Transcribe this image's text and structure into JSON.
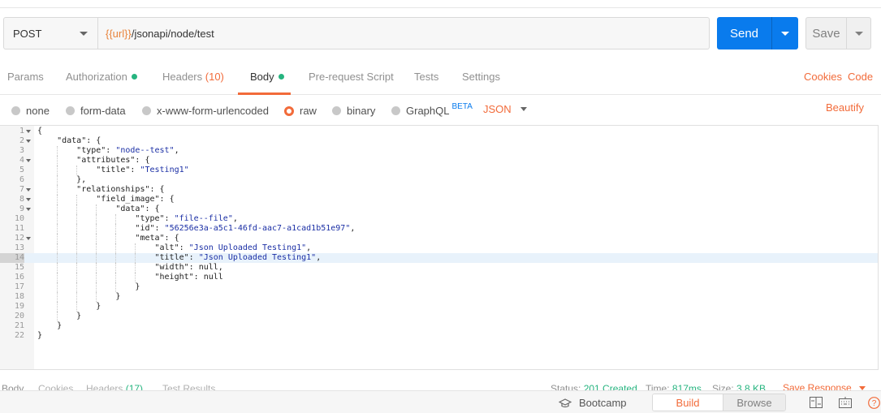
{
  "request": {
    "method": "POST",
    "url_var": "{{url}}",
    "url_path": "/jsonapi/node/test",
    "send_label": "Send",
    "save_label": "Save"
  },
  "tabs": [
    {
      "label": "Params"
    },
    {
      "label": "Authorization"
    },
    {
      "label": "Headers",
      "count": "(10)"
    },
    {
      "label": "Body"
    },
    {
      "label": "Pre-request Script"
    },
    {
      "label": "Tests"
    },
    {
      "label": "Settings"
    }
  ],
  "tab_links": {
    "cookies": "Cookies",
    "code": "Code"
  },
  "body_types": [
    {
      "label": "none"
    },
    {
      "label": "form-data"
    },
    {
      "label": "x-www-form-urlencoded"
    },
    {
      "label": "raw",
      "selected": true
    },
    {
      "label": "binary"
    },
    {
      "label": "GraphQL",
      "badge": "BETA"
    }
  ],
  "language": "JSON",
  "beautify": "Beautify",
  "editor": {
    "highlight_line": 14,
    "lines": [
      "{",
      "    \"data\": {",
      "        \"type\": \"node--test\",",
      "        \"attributes\": {",
      "            \"title\": \"Testing1\"",
      "        },",
      "        \"relationships\": {",
      "            \"field_image\": {",
      "                \"data\": {",
      "                    \"type\": \"file--file\",",
      "                    \"id\": \"56256e3a-a5c1-46fd-aac7-a1cad1b51e97\",",
      "                    \"meta\": {",
      "                        \"alt\": \"Json Uploaded Testing1\",",
      "                        \"title\": \"Json Uploaded Testing1\",",
      "                        \"width\": null,",
      "                        \"height\": null",
      "                    }",
      "                }",
      "            }",
      "        }",
      "    }",
      "}"
    ],
    "foldable": [
      1,
      2,
      4,
      7,
      8,
      9,
      12
    ]
  },
  "response": {
    "tabs": [
      "Body",
      "Cookies",
      "Headers",
      "Test Results"
    ],
    "headers_count": "(17)",
    "status_label": "Status:",
    "status_value": "201 Created",
    "time_label": "Time:",
    "time_value": "817ms",
    "size_label": "Size:",
    "size_value": "3.8 KB",
    "save_response": "Save Response"
  },
  "statusbar": {
    "bootcamp": "Bootcamp",
    "build": "Build",
    "browse": "Browse"
  }
}
